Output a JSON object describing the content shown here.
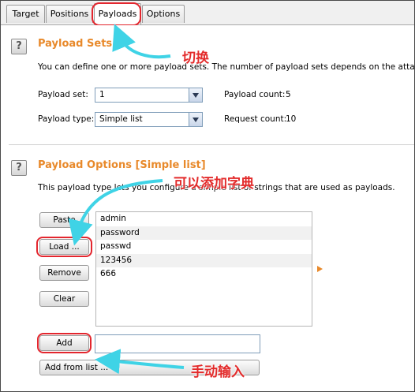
{
  "tabs": [
    {
      "label": "Target"
    },
    {
      "label": "Positions"
    },
    {
      "label": "Payloads"
    },
    {
      "label": "Options"
    }
  ],
  "payload_sets": {
    "title": "Payload Sets",
    "description": "You can define one or more payload sets. The number of payload sets depends on the attack type",
    "payload_set_label": "Payload set:",
    "payload_set_value": "1",
    "payload_count_label": "Payload count:",
    "payload_count_value": "5",
    "payload_type_label": "Payload type:",
    "payload_type_value": "Simple list",
    "request_count_label": "Request count:",
    "request_count_value": "10"
  },
  "payload_options": {
    "title": "Payload Options [Simple list]",
    "description": "This payload type lets you configure a simple list of strings that are used as payloads.",
    "buttons": {
      "paste": "Paste",
      "load": "Load ...",
      "remove": "Remove",
      "clear": "Clear",
      "add": "Add",
      "add_from_list": "Add from list ..."
    },
    "items": [
      "admin",
      "password",
      "passwd",
      "123456",
      "666"
    ],
    "add_input_value": ""
  },
  "annotations": {
    "switch": "切换",
    "can_add_dict": "可以添加字典",
    "manual_input": "手动输入"
  },
  "colors": {
    "section_title": "#e8892a",
    "annotation_text": "#e32b2b",
    "annotation_arrow": "#3fd3e6",
    "highlight_ring": "#e3262e"
  },
  "icons": {
    "help": "?"
  }
}
